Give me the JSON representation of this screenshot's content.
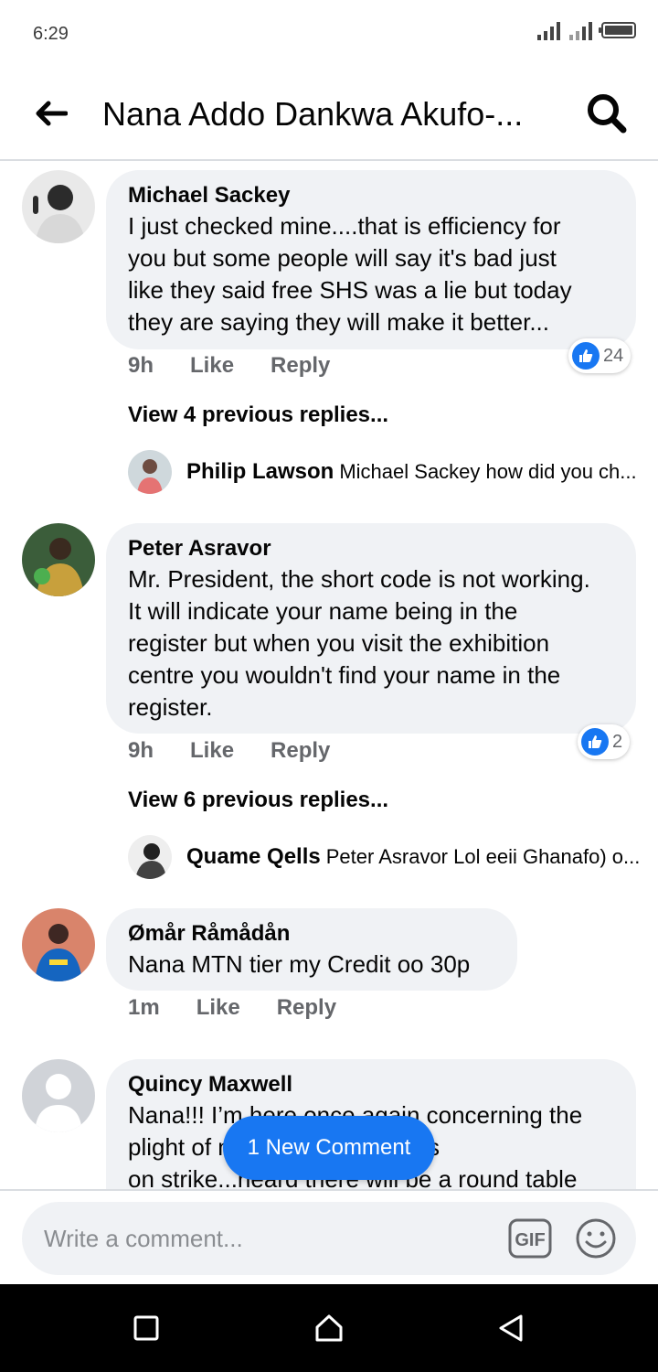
{
  "status": {
    "time": "6:29"
  },
  "header": {
    "title": "Nana Addo Dankwa Akufo-..."
  },
  "comments": [
    {
      "author": "Michael Sackey",
      "lines": [
        "I just checked mine....that is efficiency for",
        "you but some people will say it's bad just",
        "like they said free SHS was a lie but today",
        "they are saying they will make it better..."
      ],
      "time": "9h",
      "like": "Like",
      "reply": "Reply",
      "reactions": "24",
      "view_previous": "View 4 previous replies...",
      "latest_reply": {
        "author": "Philip Lawson",
        "text": "Michael Sackey how did you ch..."
      }
    },
    {
      "author": "Peter Asravor",
      "lines": [
        "Mr. President, the short code is not working.",
        "It will indicate your name being in the",
        "register but when you visit the exhibition",
        "centre you wouldn't find your name in the",
        "register."
      ],
      "time": "9h",
      "like": "Like",
      "reply": "Reply",
      "reactions": "2",
      "view_previous": "View 6 previous replies...",
      "latest_reply": {
        "author": "Quame Qells",
        "text": "Peter Asravor Lol eeii Ghanafo) o..."
      }
    },
    {
      "author": "Ømår Råmådån",
      "lines": [
        "Nana MTN tier my Credit oo 30p"
      ],
      "time": "1m",
      "like": "Like",
      "reply": "Reply"
    },
    {
      "author": "Quincy Maxwell",
      "lines": [
        "Nana!!! I’m here once again concerning the",
        "plight of nurses and midwives",
        "on strike...heard there will be a round table"
      ]
    }
  ],
  "new_comment_pill": "1 New Comment",
  "composer": {
    "placeholder": "Write a comment...",
    "gif_label": "GIF"
  },
  "colors": {
    "accent": "#1877f2",
    "bubble": "#f0f2f5",
    "muted": "#65676b"
  }
}
